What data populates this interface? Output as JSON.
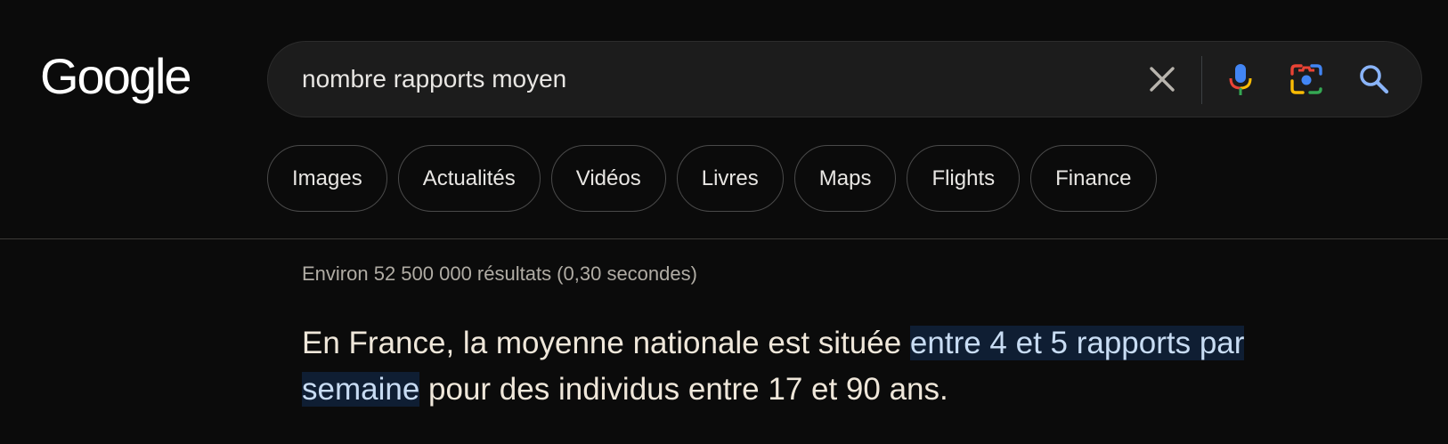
{
  "logo": {
    "text": "Google"
  },
  "search": {
    "query": "nombre rapports moyen"
  },
  "icons": {
    "clear": "close-icon",
    "mic": "mic-icon",
    "lens": "camera-lens-icon",
    "search": "search-icon"
  },
  "chips": [
    {
      "label": "Images"
    },
    {
      "label": "Actualités"
    },
    {
      "label": "Vidéos"
    },
    {
      "label": "Livres"
    },
    {
      "label": "Maps"
    },
    {
      "label": "Flights"
    },
    {
      "label": "Finance"
    }
  ],
  "results": {
    "stats": "Environ 52 500 000 résultats (0,30 secondes)"
  },
  "answer": {
    "before": "En France, la moyenne nationale est située ",
    "highlight": "entre 4 et 5 rapports par semaine",
    "after": " pour des individus entre 17 et 90 ans."
  },
  "colors": {
    "background": "#0b0b0b",
    "searchbox": "#1c1c1c",
    "highlight_bg": "#0f1e33",
    "highlight_text": "#c8dcf3",
    "search_icon": "#8ab4f8"
  }
}
